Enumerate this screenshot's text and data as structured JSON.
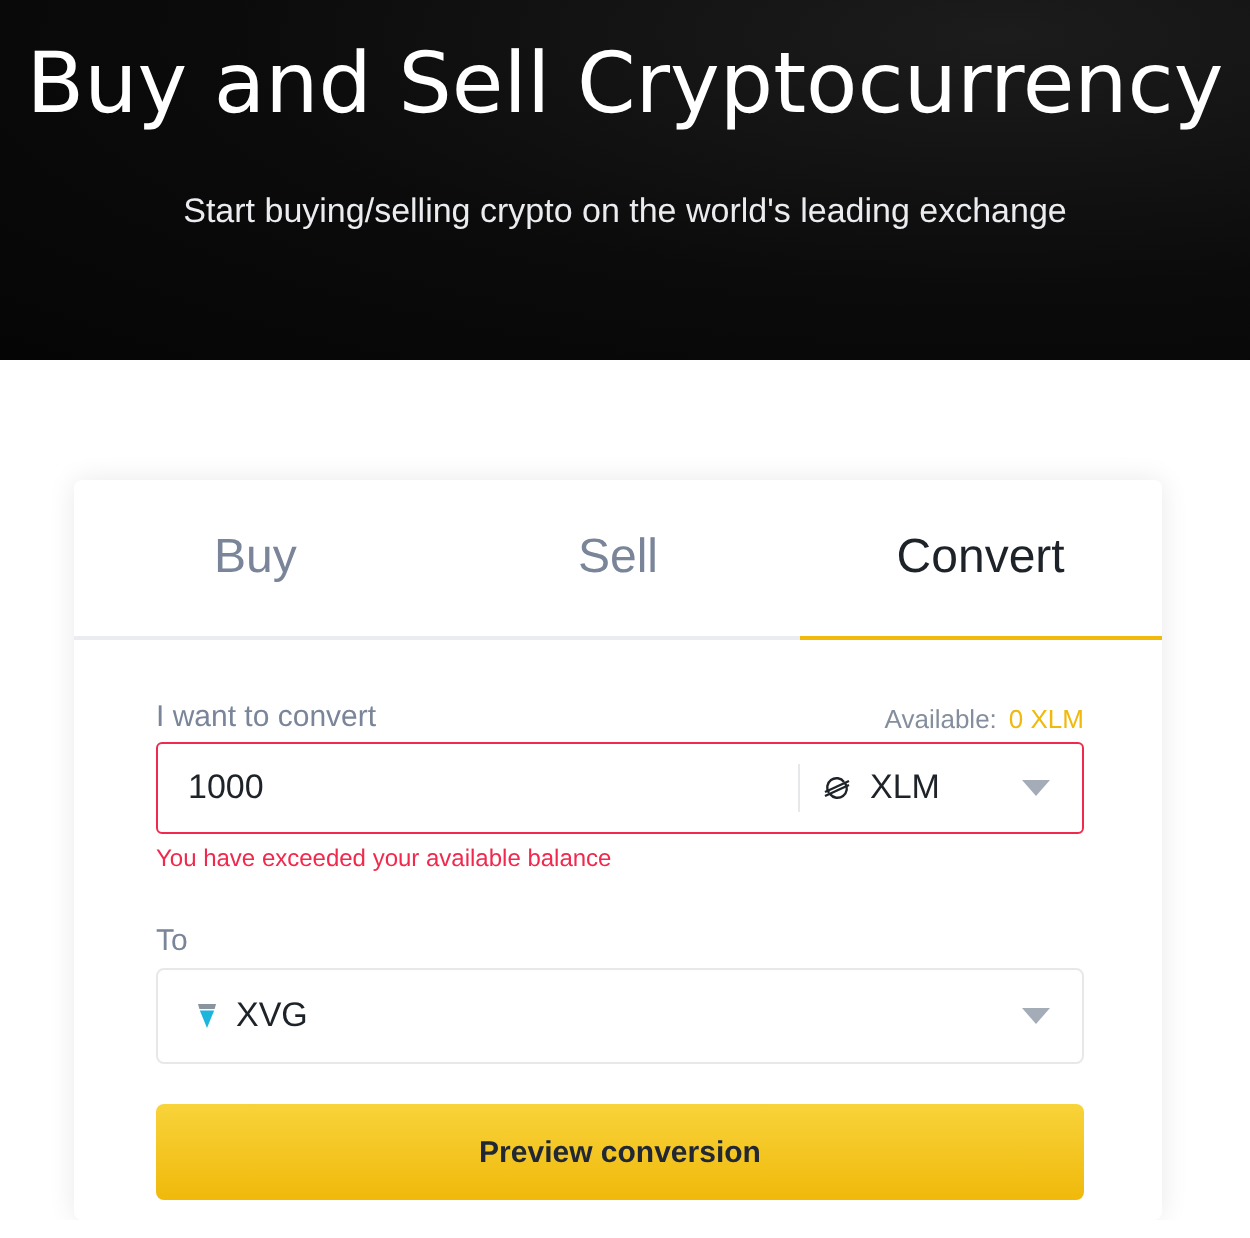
{
  "hero": {
    "title": "Buy and Sell Cryptocurrency",
    "subtitle": "Start buying/selling crypto on the world's leading exchange"
  },
  "tabs": [
    {
      "label": "Buy",
      "selected": false
    },
    {
      "label": "Sell",
      "selected": false
    },
    {
      "label": "Convert",
      "selected": true
    }
  ],
  "from": {
    "label": "I want to convert",
    "available_label": "Available:",
    "available_value": "0 XLM",
    "value": "1000",
    "currency": "XLM",
    "error": "You have exceeded your available balance"
  },
  "to": {
    "label": "To",
    "currency": "XVG"
  },
  "button": "Preview conversion"
}
